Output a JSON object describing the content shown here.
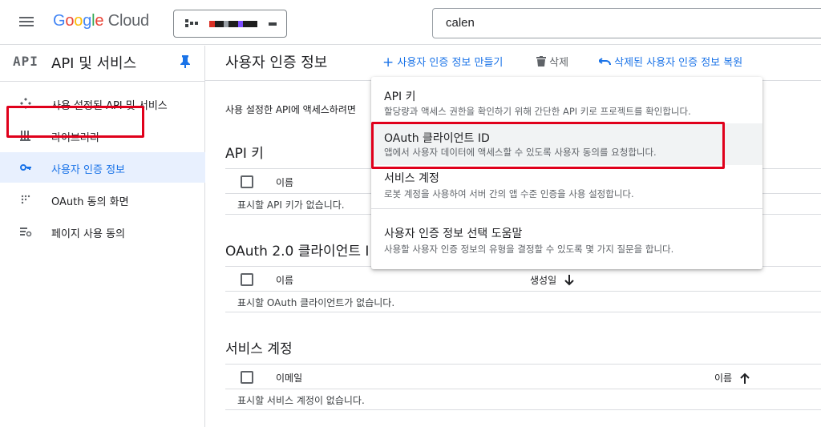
{
  "header": {
    "logo_google": [
      "G",
      "o",
      "o",
      "g",
      "l",
      "e"
    ],
    "logo_cloud": "Cloud",
    "search": {
      "value": "calen"
    }
  },
  "sidebar": {
    "badge": "API",
    "title": "API 및 서비스",
    "items": [
      {
        "label": "사용 설정된 API 및 서비스",
        "icon": "diamond-arrows-icon"
      },
      {
        "label": "라이브러리",
        "icon": "library-icon"
      },
      {
        "label": "사용자 인증 정보",
        "icon": "key-icon",
        "active": true
      },
      {
        "label": "OAuth 동의 화면",
        "icon": "dots-grid-icon"
      },
      {
        "label": "페이지 사용 동의",
        "icon": "settings-list-icon"
      }
    ]
  },
  "main": {
    "title": "사용자 인증 정보",
    "toolbar": {
      "create": "사용자 인증 정보 만들기",
      "delete": "삭제",
      "restore": "삭제된 사용자 인증 정보 복원"
    },
    "intro": "사용 설정한 API에 액세스하려면",
    "sections": [
      {
        "title": "API 키",
        "columns": [
          "이름"
        ],
        "empty": "표시할 API 키가 없습니다."
      },
      {
        "title": "OAuth 2.0 클라이언트 I",
        "columns": [
          "이름",
          "생성일"
        ],
        "sort_column": "생성일",
        "sort_direction": "down",
        "empty": "표시할 OAuth 클라이언트가 없습니다."
      },
      {
        "title": "서비스 계정",
        "columns": [
          "이메일",
          "이름"
        ],
        "sort_column": "이름",
        "sort_direction": "up",
        "empty": "표시할 서비스 계정이 없습니다."
      }
    ]
  },
  "dropdown": {
    "items": [
      {
        "title": "API 키",
        "desc": "할당량과 액세스 권한을 확인하기 위해 간단한 API 키로 프로젝트를 확인합니다."
      },
      {
        "title": "OAuth 클라이언트 ID",
        "desc": "앱에서 사용자 데이터에 액세스할 수 있도록 사용자 동의를 요청합니다."
      },
      {
        "title": "서비스 계정",
        "desc": "로봇 계정을 사용하여 서버 간의 앱 수준 인증을 사용 설정합니다."
      },
      {
        "title": "사용자 인증 정보 선택 도움말",
        "desc": "사용할 사용자 인증 정보의 유형을 결정할 수 있도록 몇 가지 질문을 합니다."
      }
    ]
  },
  "colors": {
    "accent": "#1a73e8",
    "highlight": "#e0001b",
    "active_bg": "#e8f0fe"
  }
}
